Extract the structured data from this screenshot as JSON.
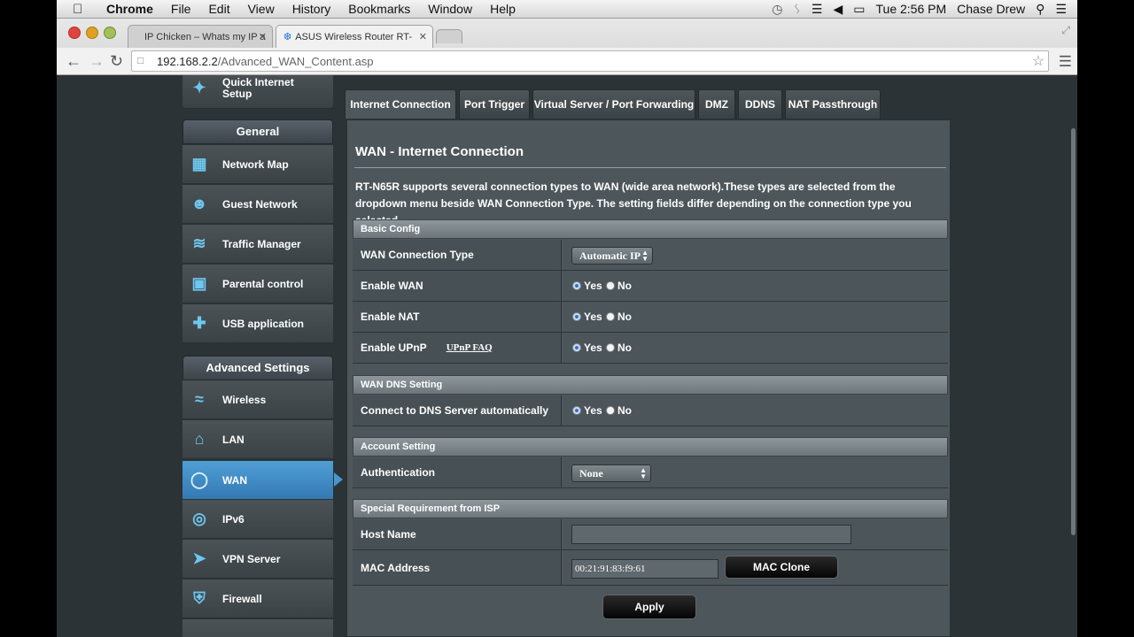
{
  "menubar": {
    "app": "Chrome",
    "items": [
      "File",
      "Edit",
      "View",
      "History",
      "Bookmarks",
      "Window",
      "Help"
    ],
    "clock": "Tue 2:56 PM",
    "user": "Chase Drew"
  },
  "browser": {
    "tabs": [
      {
        "label": "IP Chicken – Whats my IP a"
      },
      {
        "label": "ASUS Wireless Router RT-"
      }
    ],
    "url_host": "192.168.2.2",
    "url_path": "/Advanced_WAN_Content.asp"
  },
  "sidebar": {
    "quick_setup": "Quick Internet Setup",
    "general_header": "General",
    "general_items": [
      {
        "label": "Network Map",
        "icon": "network-map-icon"
      },
      {
        "label": "Guest Network",
        "icon": "guest-network-icon"
      },
      {
        "label": "Traffic Manager",
        "icon": "traffic-manager-icon"
      },
      {
        "label": "Parental control",
        "icon": "lock-icon"
      },
      {
        "label": "USB application",
        "icon": "puzzle-icon"
      }
    ],
    "advanced_header": "Advanced Settings",
    "advanced_items": [
      {
        "label": "Wireless",
        "icon": "wifi-icon"
      },
      {
        "label": "LAN",
        "icon": "home-icon"
      },
      {
        "label": "WAN",
        "icon": "globe-icon"
      },
      {
        "label": "IPv6",
        "icon": "ipv6-icon"
      },
      {
        "label": "VPN Server",
        "icon": "vpn-icon"
      },
      {
        "label": "Firewall",
        "icon": "shield-icon"
      }
    ]
  },
  "tabs": [
    "Internet Connection",
    "Port Trigger",
    "Virtual Server / Port Forwarding",
    "DMZ",
    "DDNS",
    "NAT Passthrough"
  ],
  "content": {
    "title": "WAN - Internet Connection",
    "description": "RT-N65R supports several connection types to WAN (wide area network).These types are selected from the dropdown menu beside WAN Connection Type. The setting fields differ depending on the connection type you selected.",
    "basic_config": {
      "header": "Basic Config",
      "wan_type_label": "WAN Connection Type",
      "wan_type_value": "Automatic IP",
      "enable_wan": "Enable WAN",
      "enable_nat": "Enable NAT",
      "enable_upnp": "Enable UPnP",
      "upnp_faq": "UPnP FAQ"
    },
    "radio": {
      "yes": "Yes",
      "no": "No"
    },
    "wan_dns": {
      "header": "WAN DNS Setting",
      "connect_dns": "Connect to DNS Server automatically"
    },
    "account": {
      "header": "Account Setting",
      "auth_label": "Authentication",
      "auth_value": "None"
    },
    "isp": {
      "header": "Special Requirement from ISP",
      "host_label": "Host Name",
      "host_value": "",
      "mac_label": "MAC Address",
      "mac_value": "00:21:91:83:f9:61",
      "mac_clone": "MAC Clone"
    },
    "apply": "Apply"
  }
}
